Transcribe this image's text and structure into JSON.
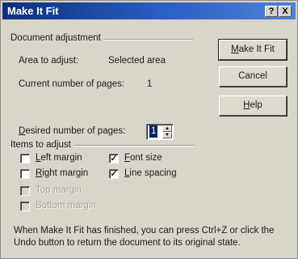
{
  "window": {
    "title": "Make It Fit",
    "help_button": "?",
    "close_button": "X"
  },
  "document_adjustment": {
    "group_label": "Document adjustment",
    "area_label": "Area to adjust:",
    "area_value": "Selected area",
    "current_pages_label": "Current number of pages:",
    "current_pages_value": "1",
    "desired_pages_label": "Desired number of pages:",
    "desired_pages_value": "1"
  },
  "buttons": {
    "make_it_fit": "Make It Fit",
    "cancel": "Cancel",
    "help": "Help"
  },
  "items_to_adjust": {
    "group_label": "Items to adjust",
    "left_margin": {
      "label": "Left margin",
      "checked": false,
      "enabled": true
    },
    "right_margin": {
      "label": "Right margin",
      "checked": false,
      "enabled": true
    },
    "top_margin": {
      "label": "Top margin",
      "checked": false,
      "enabled": false
    },
    "bottom_margin": {
      "label": "Bottom margin",
      "checked": false,
      "enabled": false
    },
    "font_size": {
      "label": "Font size",
      "checked": true,
      "enabled": true
    },
    "line_spacing": {
      "label": "Line spacing",
      "checked": true,
      "enabled": true
    }
  },
  "footer_text": "When Make It Fit has finished, you can press Ctrl+Z or click the Undo button to return the document to its original state."
}
